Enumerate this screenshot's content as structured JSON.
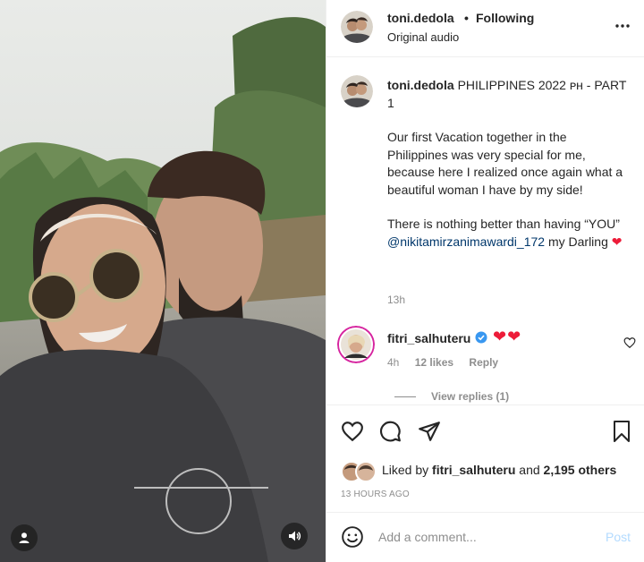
{
  "header": {
    "username": "toni.dedola",
    "separator": "•",
    "follow_label": "Following",
    "subtitle": "Original audio",
    "more_icon": "more-horizontal-icon"
  },
  "caption": {
    "username": "toni.dedola",
    "title": "PHILIPPINES 2022 ᴘʜ - PART 1",
    "paragraph1": "Our first Vacation together in the Philippines was very special for me, because here I realized once again what a beautiful woman I have by my side!",
    "paragraph2_prefix": "There is nothing better than having “YOU”",
    "mention": "@nikitamirzanimawardi_172",
    "paragraph2_suffix": "my Darling",
    "heart": "❤",
    "time": "13h"
  },
  "comment": {
    "username": "fitri_salhuteru",
    "text": "❤❤",
    "time": "4h",
    "likes": "12 likes",
    "reply_label": "Reply",
    "view_replies": "View replies (1)"
  },
  "actions": {
    "liked_prefix": "Liked by",
    "liked_user": "fitri_salhuteru",
    "liked_and": "and",
    "liked_others": "2,195 others",
    "timeago": "13 HOURS AGO"
  },
  "comment_bar": {
    "placeholder": "Add a comment...",
    "post_label": "Post"
  },
  "colors": {
    "link": "#00376b",
    "heart": "#ed1c39",
    "verified": "#3897f0",
    "secondary_text": "#8e8e8e",
    "post_disabled": "#b3dbff"
  }
}
